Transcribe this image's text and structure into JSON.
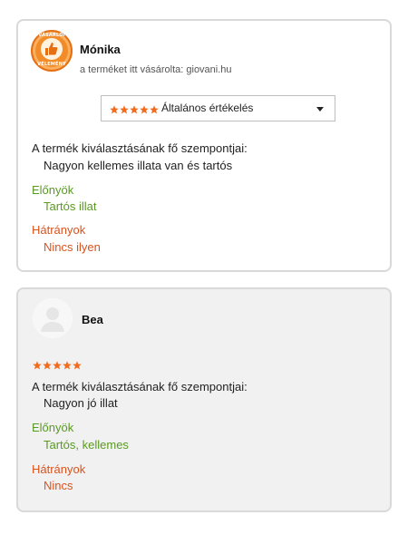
{
  "reviews": [
    {
      "badge": {
        "top_text": "VÁSÁRLÓI",
        "bottom_text": "VÉLEMÉNY"
      },
      "name": "Mónika",
      "bought_text": "a terméket itt vásárolta: giovani.hu",
      "rating_select": {
        "stars": 5,
        "label": "Általános értékelés"
      },
      "criteria_title": "A termék kiválasztásának fő szempontjai:",
      "criteria_text": "Nagyon kellemes illata van és tartós",
      "pros_title": "Előnyök",
      "pros_text": "Tartós illat",
      "cons_title": "Hátrányok",
      "cons_text": "Nincs ilyen"
    },
    {
      "name": "Bea",
      "stars": 5,
      "criteria_title": "A termék kiválasztásának fő szempontjai:",
      "criteria_text": "Nagyon jó illat",
      "pros_title": "Előnyök",
      "pros_text": "Tartós, kellemes",
      "cons_title": "Hátrányok",
      "cons_text": "Nincs"
    }
  ],
  "colors": {
    "star": "#f26b1d",
    "pros": "#5a9a22",
    "cons": "#d9531e",
    "badge": "#f28c28"
  }
}
